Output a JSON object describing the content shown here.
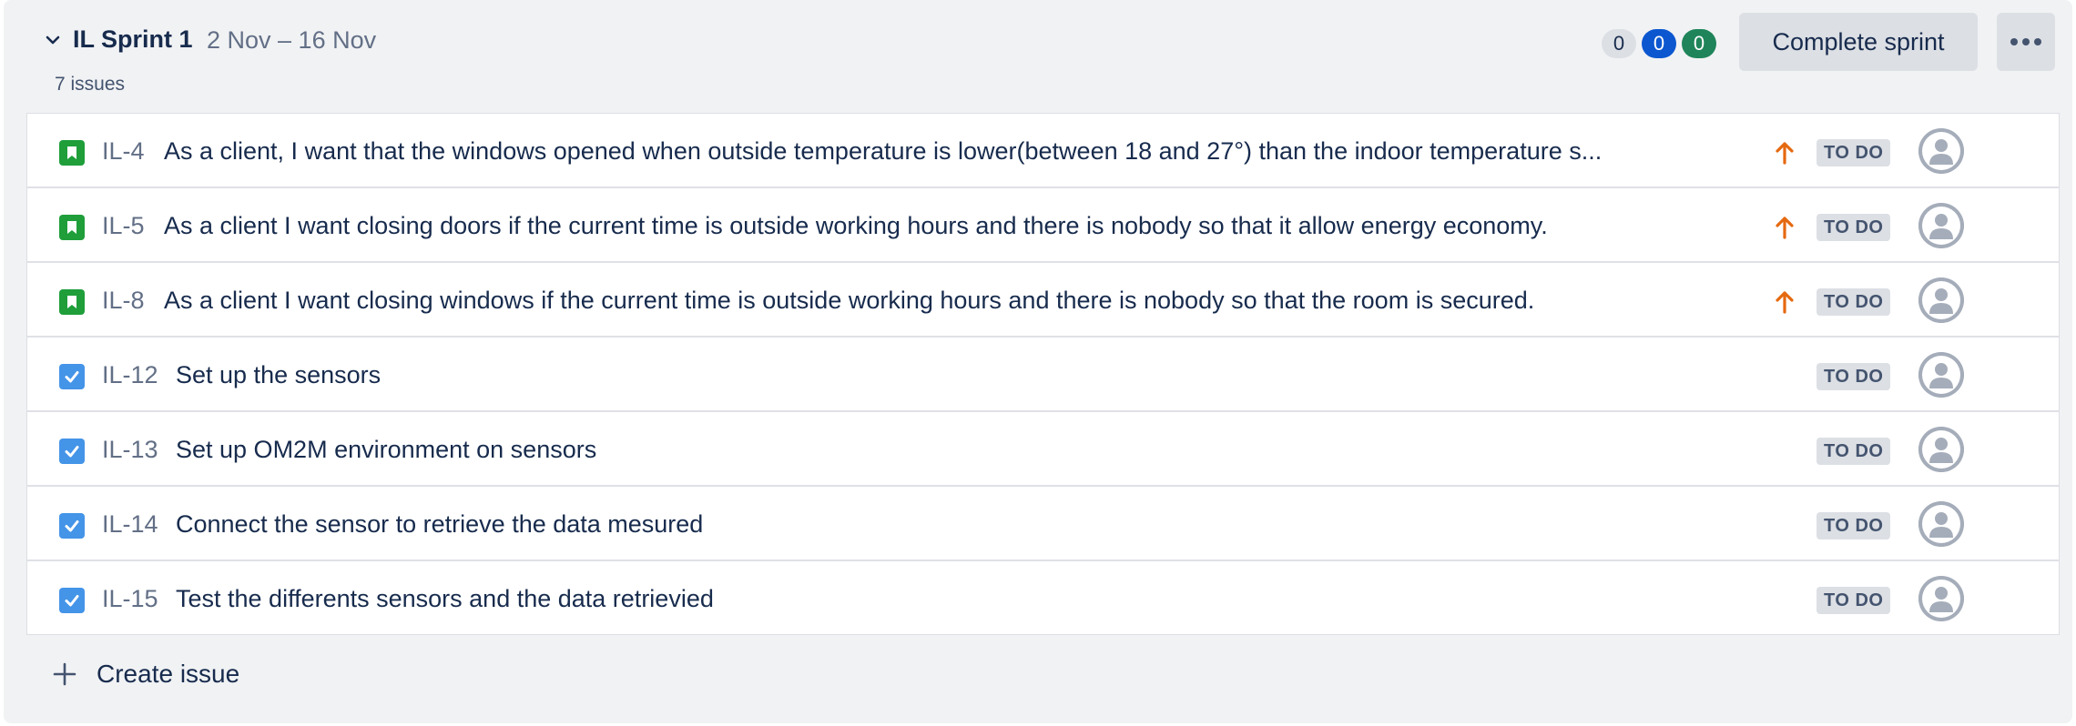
{
  "sprint": {
    "name": "IL Sprint 1",
    "dates": "2 Nov – 16 Nov",
    "issue_count": "7 issues",
    "counts": {
      "todo": "0",
      "in_progress": "0",
      "done": "0"
    },
    "complete_label": "Complete sprint",
    "more_icon": "more-horizontal-icon",
    "expand_icon": "chevron-down-icon"
  },
  "issues": [
    {
      "key": "IL-4",
      "type": "story",
      "summary": "As a client, I want that the windows opened when outside temperature is lower(between 18 and 27°) than the indoor temperature s...",
      "priority": "high",
      "status": "TO DO"
    },
    {
      "key": "IL-5",
      "type": "story",
      "summary": "As a client I want closing doors if the current time is outside working hours and there is nobody so that it allow energy economy.",
      "priority": "high",
      "status": "TO DO"
    },
    {
      "key": "IL-8",
      "type": "story",
      "summary": "As a client I want closing windows if the current time is outside working hours and there is nobody so that the room is secured.",
      "priority": "high",
      "status": "TO DO"
    },
    {
      "key": "IL-12",
      "type": "task",
      "summary": "Set up the sensors",
      "priority": "",
      "status": "TO DO"
    },
    {
      "key": "IL-13",
      "type": "task",
      "summary": "Set up OM2M environment on sensors",
      "priority": "",
      "status": "TO DO"
    },
    {
      "key": "IL-14",
      "type": "task",
      "summary": "Connect the sensor to retrieve the data mesured",
      "priority": "",
      "status": "TO DO"
    },
    {
      "key": "IL-15",
      "type": "task",
      "summary": "Test the differents sensors and the data retrievied",
      "priority": "",
      "status": "TO DO"
    }
  ],
  "create_issue": {
    "label": "Create issue",
    "icon": "plus-icon"
  },
  "colors": {
    "story": "#1f9e3a",
    "task": "#4494e8",
    "priority_high": "#e56910",
    "in_progress": "#0c57d0",
    "done": "#1f845a"
  }
}
